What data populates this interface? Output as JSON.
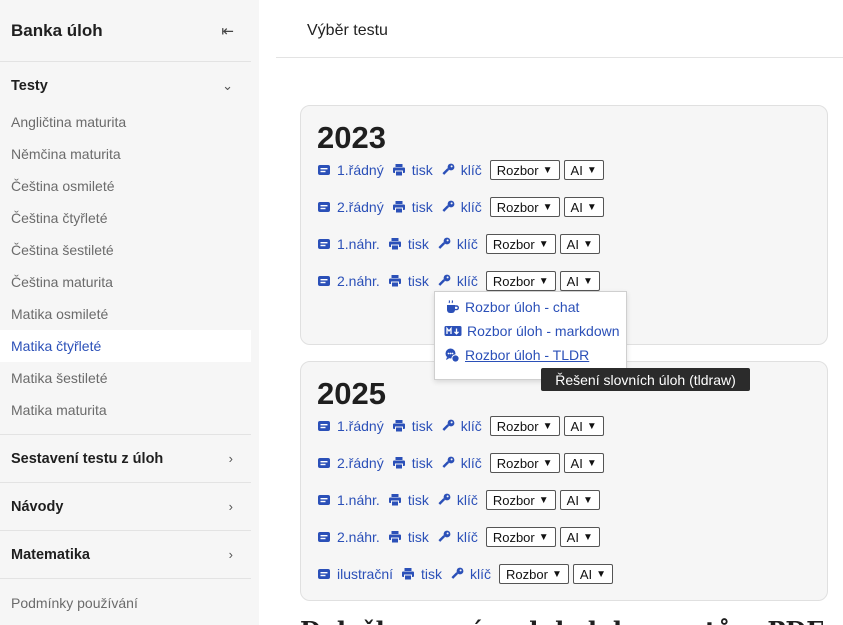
{
  "sidebar": {
    "title": "Banka úloh",
    "collapse_icon": "collapse-left-icon",
    "sections": [
      {
        "label": "Testy",
        "expanded": true
      },
      {
        "label": "Sestavení testu z úloh"
      },
      {
        "label": "Návody"
      },
      {
        "label": "Matematika"
      }
    ],
    "tests": [
      "Angličtina maturita",
      "Němčina maturita",
      "Čeština osmileté",
      "Čeština čtyřleté",
      "Čeština šestileté",
      "Čeština maturita",
      "Matika osmileté",
      "Matika čtyřleté",
      "Matika šestileté",
      "Matika maturita"
    ],
    "active_test": "Matika čtyřleté",
    "footer": "Podmínky používání"
  },
  "header": {
    "title": "Výběr testu"
  },
  "links": {
    "print": "tisk",
    "key": "klíč",
    "rozbor": "Rozbor",
    "ai": "AI"
  },
  "years": [
    {
      "year": "2023",
      "tests": [
        "1.řádný",
        "2.řádný",
        "1.náhr.",
        "2.náhr."
      ]
    },
    {
      "year": "2025",
      "tests": [
        "1.řádný",
        "2.řádný",
        "1.náhr.",
        "2.náhr.",
        "ilustrační"
      ]
    }
  ],
  "dropdown": {
    "items": [
      "Rozbor úloh - chat",
      "Rozbor úloh - markdown",
      "Rozbor úloh - TLDR"
    ],
    "hovered": "Rozbor úloh - TLDR"
  },
  "tooltip": "Řešení slovních úloh (tldraw)",
  "bottom_heading": "Doložka o právech k dokumentům PDF",
  "colors": {
    "link": "#2b50b8",
    "sidebar_bg": "#f6f6f6",
    "tooltip_bg": "#2b2b2b"
  }
}
